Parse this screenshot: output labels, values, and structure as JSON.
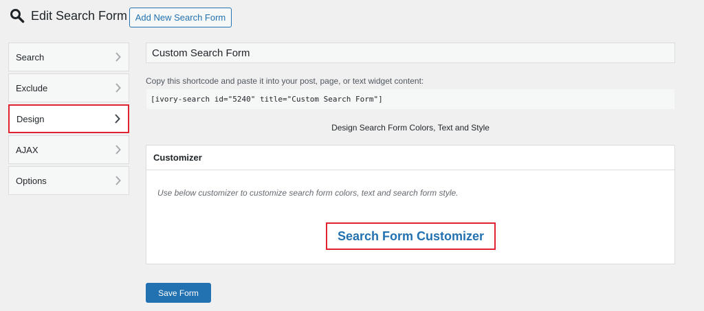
{
  "header": {
    "title": "Edit Search Form",
    "add_new_label": "Add New Search Form"
  },
  "tabs": [
    {
      "label": "Search",
      "active": false
    },
    {
      "label": "Exclude",
      "active": false
    },
    {
      "label": "Design",
      "active": true
    },
    {
      "label": "AJAX",
      "active": false
    },
    {
      "label": "Options",
      "active": false
    }
  ],
  "form": {
    "title_value": "Custom Search Form",
    "shortcode_label": "Copy this shortcode and paste it into your post, page, or text widget content:",
    "shortcode": "[ivory-search id=\"5240\" title=\"Custom Search Form\"]",
    "section_caption": "Design Search Form Colors, Text and Style"
  },
  "customizer": {
    "heading": "Customizer",
    "description": "Use below customizer to customize search form colors, text and search form style.",
    "link_label": "Search Form Customizer"
  },
  "actions": {
    "save_label": "Save Form"
  },
  "colors": {
    "accent": "#2271b1",
    "highlight": "#e0212f",
    "background": "#f0f0f1"
  },
  "icons": {
    "title_icon": "magnifier-icon",
    "tab_icon": "chevron-right-icon"
  }
}
